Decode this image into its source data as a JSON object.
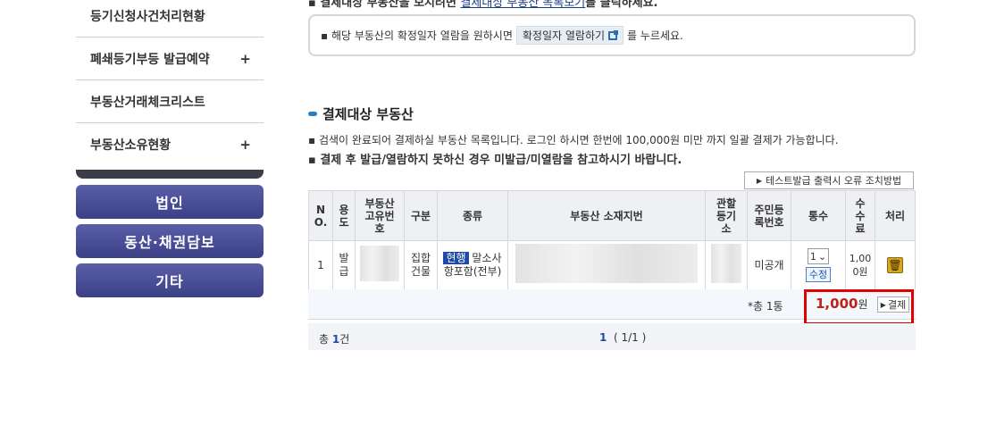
{
  "sidebar": {
    "items": [
      {
        "label": "등기신청사건처리현황",
        "plus": ""
      },
      {
        "label": "폐쇄등기부등 발급예약",
        "plus": "+"
      },
      {
        "label": "부동산거래체크리스트",
        "plus": ""
      },
      {
        "label": "부동산소유현황",
        "plus": "+"
      }
    ],
    "categories": [
      "법인",
      "동산·채권담보",
      "기타"
    ]
  },
  "top": {
    "prefix": "▪ 결제대상 부동산을 보시려면 ",
    "link": "결제대상 부동산 목록보기",
    "suffix": "를 클릭하세요."
  },
  "notice": {
    "prefix": "▪ 해당 부동산의 확정일자 열람을 원하시면",
    "button": "확정일자 열람하기",
    "suffix": "를 누르세요."
  },
  "section": {
    "title": "결제대상 부동산",
    "desc1": "▪ 검색이 완료되어 결제하실 부동산 목록입니다. 로그인 하시면 한번에 100,000원 미만 까지 일괄 결제가 가능합니다.",
    "desc2": "▪ 결제 후 발급/열람하지 못하신 경우 미발급/미열람을 참고하시기 바랍니다.",
    "test_button": "테스트발급 출력시 오류 조치방법"
  },
  "table": {
    "headers": [
      "N\nO.",
      "용\n도",
      "부동산\n고유번\n호",
      "구분",
      "종류",
      "부동산 소재지번",
      "관할\n등기\n소",
      "주민등\n록번호",
      "통수",
      "수\n수\n료",
      "처리"
    ],
    "row": {
      "no": "1",
      "use": "발\n급",
      "category": "집합\n건물",
      "badge": "현행",
      "kind_rest": " 말소사",
      "kind_line2": "항포함(전부)",
      "resident": "미공개",
      "copies_value": "1",
      "modify": "수정",
      "fee": "1,00\n0원"
    }
  },
  "summary": {
    "count": "*총 1통",
    "amount": "1,000",
    "won": "원",
    "pay_button": "결제"
  },
  "footer": {
    "total_prefix": "총 ",
    "total_count": "1",
    "total_suffix": "건",
    "page_current": "1",
    "page_info": "  ( 1/1 )"
  }
}
